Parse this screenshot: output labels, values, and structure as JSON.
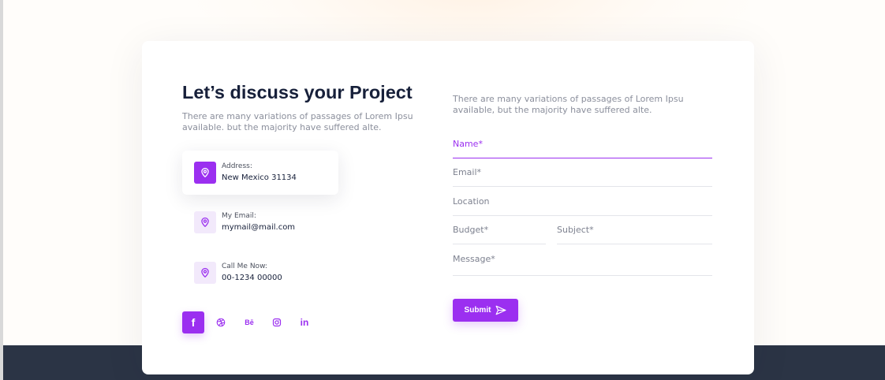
{
  "contact": {
    "heading": "Let’s discuss your Project",
    "intro": "There are many variations of passages of Lorem Ipsu available. but the majority have suffered alte.",
    "info": [
      {
        "label": "Address:",
        "value": "New Mexico 31134",
        "icon": "location-pin-icon",
        "active": true
      },
      {
        "label": "My Email:",
        "value": "mymail@mail.com",
        "icon": "location-pin-icon",
        "active": false
      },
      {
        "label": "Call Me Now:",
        "value": "00-1234 00000",
        "icon": "location-pin-icon",
        "active": false
      }
    ],
    "social": [
      {
        "name": "facebook-icon",
        "glyph": "f"
      },
      {
        "name": "dribbble-icon",
        "glyph": ""
      },
      {
        "name": "behance-icon",
        "glyph": "Bē"
      },
      {
        "name": "instagram-icon",
        "glyph": ""
      },
      {
        "name": "linkedin-icon",
        "glyph": "in"
      }
    ]
  },
  "form": {
    "intro": "There are many variations of passages of Lorem Ipsu available, but the majority have suffered alte.",
    "name_placeholder": "Name*",
    "email_placeholder": "Email*",
    "location_placeholder": "Location",
    "budget_placeholder": "Budget*",
    "subject_placeholder": "Subject*",
    "message_placeholder": "Message*",
    "submit_label": "Submit"
  },
  "colors": {
    "accent": "#9b2ff0",
    "accent_light": "#f2e9fb",
    "heading": "#17203a",
    "body_text": "#8b8f9c",
    "footer": "#2b3445"
  }
}
